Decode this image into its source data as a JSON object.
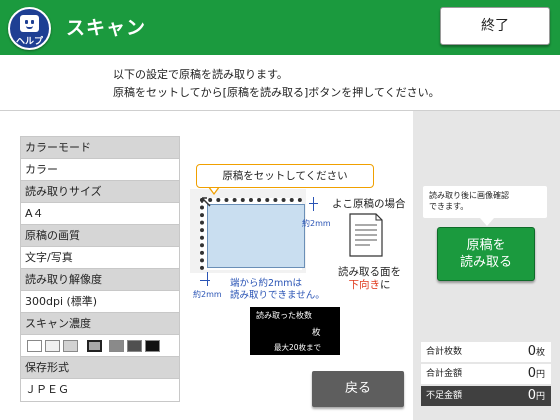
{
  "header": {
    "help_label": "ヘルプ",
    "title": "スキャン",
    "close_label": "終了"
  },
  "instructions": {
    "line1": "以下の設定で原稿を読み取ります。",
    "line2": "原稿をセットしてから[原稿を読み取る]ボタンを押してください。"
  },
  "settings": {
    "color_mode": {
      "label": "カラーモード",
      "value": "カラー"
    },
    "scan_size": {
      "label": "読み取りサイズ",
      "value": "A４"
    },
    "image_quality": {
      "label": "原稿の画質",
      "value": "文字/写真"
    },
    "resolution": {
      "label": "読み取り解像度",
      "value": "300dpi (標準)"
    },
    "density": {
      "label": "スキャン濃度",
      "levels": 7,
      "selected_level": 4
    },
    "file_format": {
      "label": "保存形式",
      "value": "ＪＰＥＧ"
    }
  },
  "diagram": {
    "callout": "原稿をセットしてください",
    "margin_top": "約2mm",
    "margin_left": "約2mm",
    "note_line1": "端から約2mmは",
    "note_line2": "読み取りできません。",
    "landscape_label": "よこ原稿の場合",
    "read_side_line1": "読み取る面を",
    "read_side_red": "下向き",
    "read_side_suffix": "に"
  },
  "counter": {
    "label": "読み取った枚数",
    "unit": "枚",
    "max_note": "最大20枚まで"
  },
  "back_label": "戻る",
  "right_panel": {
    "tip_line1": "読み取り後に画像確認",
    "tip_line2": "できます。",
    "read_button_line1": "原稿を",
    "read_button_line2": "読み取る",
    "total_sheets": {
      "label": "合計枚数",
      "value": "0",
      "unit": "枚"
    },
    "total_amount": {
      "label": "合計金額",
      "value": "0",
      "unit": "円"
    },
    "shortfall": {
      "label": "不足金額",
      "value": "0",
      "unit": "円"
    }
  },
  "colors": {
    "header_green": "#1b9a3e",
    "help_blue": "#1e3f93",
    "note_blue": "#2a54b5",
    "callout_orange": "#f0a000",
    "emphasis_red": "#e03a1e"
  }
}
